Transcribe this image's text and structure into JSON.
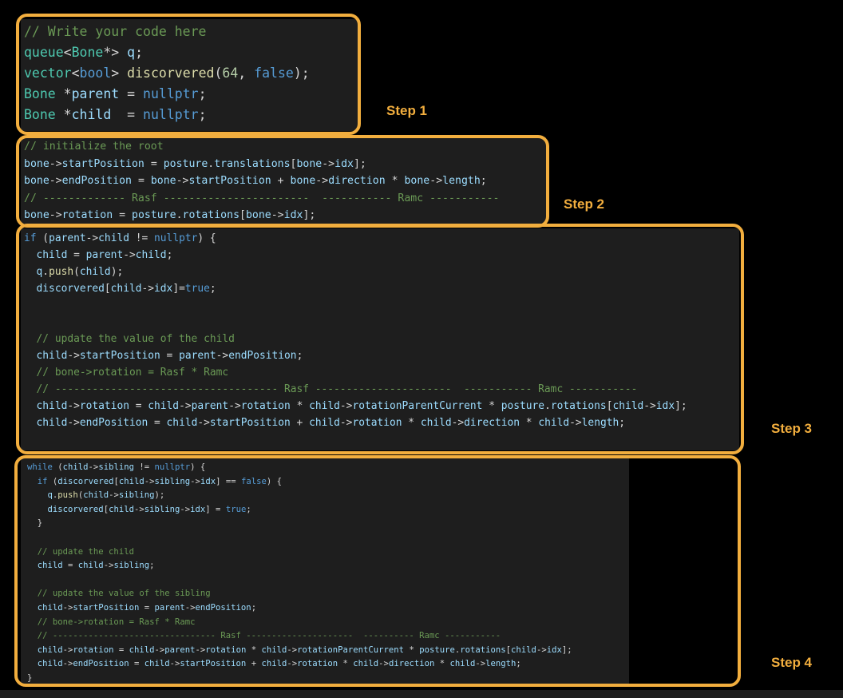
{
  "steps": [
    "Step 1",
    "Step 2",
    "Step 3",
    "Step 4"
  ],
  "code": {
    "step1": [
      [
        [
          "c",
          "// Write your code here"
        ]
      ],
      [
        [
          "t",
          "queue"
        ],
        [
          "p",
          "<"
        ],
        [
          "t",
          "Bone"
        ],
        [
          "p",
          "*> "
        ],
        [
          "v",
          "q"
        ],
        [
          "p",
          ";"
        ]
      ],
      [
        [
          "t",
          "vector"
        ],
        [
          "p",
          "<"
        ],
        [
          "k",
          "bool"
        ],
        [
          "p",
          "> "
        ],
        [
          "f",
          "discorvered"
        ],
        [
          "p",
          "("
        ],
        [
          "n",
          "64"
        ],
        [
          "p",
          ", "
        ],
        [
          "k",
          "false"
        ],
        [
          "p",
          ");"
        ]
      ],
      [
        [
          "t",
          "Bone"
        ],
        [
          "p",
          " *"
        ],
        [
          "v",
          "parent"
        ],
        [
          "p",
          " = "
        ],
        [
          "k",
          "nullptr"
        ],
        [
          "p",
          ";"
        ]
      ],
      [
        [
          "t",
          "Bone"
        ],
        [
          "p",
          " *"
        ],
        [
          "v",
          "child"
        ],
        [
          "p",
          "  = "
        ],
        [
          "k",
          "nullptr"
        ],
        [
          "p",
          ";"
        ]
      ]
    ],
    "step2": [
      [
        [
          "c",
          "// initialize the root"
        ]
      ],
      [
        [
          "v",
          "bone"
        ],
        [
          "p",
          "->"
        ],
        [
          "v",
          "startPosition"
        ],
        [
          "p",
          " = "
        ],
        [
          "v",
          "posture"
        ],
        [
          "p",
          "."
        ],
        [
          "v",
          "translations"
        ],
        [
          "p",
          "["
        ],
        [
          "v",
          "bone"
        ],
        [
          "p",
          "->"
        ],
        [
          "v",
          "idx"
        ],
        [
          "p",
          "];"
        ]
      ],
      [
        [
          "v",
          "bone"
        ],
        [
          "p",
          "->"
        ],
        [
          "v",
          "endPosition"
        ],
        [
          "p",
          " = "
        ],
        [
          "v",
          "bone"
        ],
        [
          "p",
          "->"
        ],
        [
          "v",
          "startPosition"
        ],
        [
          "p",
          " + "
        ],
        [
          "v",
          "bone"
        ],
        [
          "p",
          "->"
        ],
        [
          "v",
          "direction"
        ],
        [
          "p",
          " * "
        ],
        [
          "v",
          "bone"
        ],
        [
          "p",
          "->"
        ],
        [
          "v",
          "length"
        ],
        [
          "p",
          ";"
        ]
      ],
      [
        [
          "c",
          "// ------------- Rasf -----------------------  ----------- Ramc -----------"
        ]
      ],
      [
        [
          "v",
          "bone"
        ],
        [
          "p",
          "->"
        ],
        [
          "v",
          "rotation"
        ],
        [
          "p",
          " = "
        ],
        [
          "v",
          "posture"
        ],
        [
          "p",
          "."
        ],
        [
          "v",
          "rotations"
        ],
        [
          "p",
          "["
        ],
        [
          "v",
          "bone"
        ],
        [
          "p",
          "->"
        ],
        [
          "v",
          "idx"
        ],
        [
          "p",
          "];"
        ]
      ]
    ],
    "step3": [
      [
        [
          "k",
          "if"
        ],
        [
          "p",
          " ("
        ],
        [
          "v",
          "parent"
        ],
        [
          "p",
          "->"
        ],
        [
          "v",
          "child"
        ],
        [
          "p",
          " != "
        ],
        [
          "k",
          "nullptr"
        ],
        [
          "p",
          ") {"
        ]
      ],
      [
        [
          "p",
          "  "
        ],
        [
          "v",
          "child"
        ],
        [
          "p",
          " = "
        ],
        [
          "v",
          "parent"
        ],
        [
          "p",
          "->"
        ],
        [
          "v",
          "child"
        ],
        [
          "p",
          ";"
        ]
      ],
      [
        [
          "p",
          "  "
        ],
        [
          "v",
          "q"
        ],
        [
          "p",
          "."
        ],
        [
          "f",
          "push"
        ],
        [
          "p",
          "("
        ],
        [
          "v",
          "child"
        ],
        [
          "p",
          ");"
        ]
      ],
      [
        [
          "p",
          "  "
        ],
        [
          "v",
          "discorvered"
        ],
        [
          "p",
          "["
        ],
        [
          "v",
          "child"
        ],
        [
          "p",
          "->"
        ],
        [
          "v",
          "idx"
        ],
        [
          "p",
          "]="
        ],
        [
          "k",
          "true"
        ],
        [
          "p",
          ";"
        ]
      ],
      [
        [
          "p",
          ""
        ]
      ],
      [
        [
          "p",
          ""
        ]
      ],
      [
        [
          "p",
          "  "
        ],
        [
          "c",
          "// update the value of the child"
        ]
      ],
      [
        [
          "p",
          "  "
        ],
        [
          "v",
          "child"
        ],
        [
          "p",
          "->"
        ],
        [
          "v",
          "startPosition"
        ],
        [
          "p",
          " = "
        ],
        [
          "v",
          "parent"
        ],
        [
          "p",
          "->"
        ],
        [
          "v",
          "endPosition"
        ],
        [
          "p",
          ";"
        ]
      ],
      [
        [
          "p",
          "  "
        ],
        [
          "c",
          "// bone->rotation = Rasf * Ramc"
        ]
      ],
      [
        [
          "p",
          "  "
        ],
        [
          "c",
          "// ------------------------------------ Rasf ----------------------  ----------- Ramc -----------"
        ]
      ],
      [
        [
          "p",
          "  "
        ],
        [
          "v",
          "child"
        ],
        [
          "p",
          "->"
        ],
        [
          "v",
          "rotation"
        ],
        [
          "p",
          " = "
        ],
        [
          "v",
          "child"
        ],
        [
          "p",
          "->"
        ],
        [
          "v",
          "parent"
        ],
        [
          "p",
          "->"
        ],
        [
          "v",
          "rotation"
        ],
        [
          "p",
          " * "
        ],
        [
          "v",
          "child"
        ],
        [
          "p",
          "->"
        ],
        [
          "v",
          "rotationParentCurrent"
        ],
        [
          "p",
          " * "
        ],
        [
          "v",
          "posture"
        ],
        [
          "p",
          "."
        ],
        [
          "v",
          "rotations"
        ],
        [
          "p",
          "["
        ],
        [
          "v",
          "child"
        ],
        [
          "p",
          "->"
        ],
        [
          "v",
          "idx"
        ],
        [
          "p",
          "];"
        ]
      ],
      [
        [
          "p",
          "  "
        ],
        [
          "v",
          "child"
        ],
        [
          "p",
          "->"
        ],
        [
          "v",
          "endPosition"
        ],
        [
          "p",
          " = "
        ],
        [
          "v",
          "child"
        ],
        [
          "p",
          "->"
        ],
        [
          "v",
          "startPosition"
        ],
        [
          "p",
          " + "
        ],
        [
          "v",
          "child"
        ],
        [
          "p",
          "->"
        ],
        [
          "v",
          "rotation"
        ],
        [
          "p",
          " * "
        ],
        [
          "v",
          "child"
        ],
        [
          "p",
          "->"
        ],
        [
          "v",
          "direction"
        ],
        [
          "p",
          " * "
        ],
        [
          "v",
          "child"
        ],
        [
          "p",
          "->"
        ],
        [
          "v",
          "length"
        ],
        [
          "p",
          ";"
        ]
      ]
    ],
    "step4": [
      [
        [
          "k",
          "while"
        ],
        [
          "p",
          " ("
        ],
        [
          "v",
          "child"
        ],
        [
          "p",
          "->"
        ],
        [
          "v",
          "sibling"
        ],
        [
          "p",
          " != "
        ],
        [
          "k",
          "nullptr"
        ],
        [
          "p",
          ") {"
        ]
      ],
      [
        [
          "p",
          "  "
        ],
        [
          "k",
          "if"
        ],
        [
          "p",
          " ("
        ],
        [
          "v",
          "discorvered"
        ],
        [
          "p",
          "["
        ],
        [
          "v",
          "child"
        ],
        [
          "p",
          "->"
        ],
        [
          "v",
          "sibling"
        ],
        [
          "p",
          "->"
        ],
        [
          "v",
          "idx"
        ],
        [
          "p",
          "] == "
        ],
        [
          "k",
          "false"
        ],
        [
          "p",
          ") {"
        ]
      ],
      [
        [
          "p",
          "    "
        ],
        [
          "v",
          "q"
        ],
        [
          "p",
          "."
        ],
        [
          "f",
          "push"
        ],
        [
          "p",
          "("
        ],
        [
          "v",
          "child"
        ],
        [
          "p",
          "->"
        ],
        [
          "v",
          "sibling"
        ],
        [
          "p",
          ");"
        ]
      ],
      [
        [
          "p",
          "    "
        ],
        [
          "v",
          "discorvered"
        ],
        [
          "p",
          "["
        ],
        [
          "v",
          "child"
        ],
        [
          "p",
          "->"
        ],
        [
          "v",
          "sibling"
        ],
        [
          "p",
          "->"
        ],
        [
          "v",
          "idx"
        ],
        [
          "p",
          "] = "
        ],
        [
          "k",
          "true"
        ],
        [
          "p",
          ";"
        ]
      ],
      [
        [
          "p",
          "  }"
        ]
      ],
      [
        [
          "p",
          ""
        ]
      ],
      [
        [
          "p",
          "  "
        ],
        [
          "c",
          "// update the child"
        ]
      ],
      [
        [
          "p",
          "  "
        ],
        [
          "v",
          "child"
        ],
        [
          "p",
          " = "
        ],
        [
          "v",
          "child"
        ],
        [
          "p",
          "->"
        ],
        [
          "v",
          "sibling"
        ],
        [
          "p",
          ";"
        ]
      ],
      [
        [
          "p",
          ""
        ]
      ],
      [
        [
          "p",
          "  "
        ],
        [
          "c",
          "// update the value of the sibling"
        ]
      ],
      [
        [
          "p",
          "  "
        ],
        [
          "v",
          "child"
        ],
        [
          "p",
          "->"
        ],
        [
          "v",
          "startPosition"
        ],
        [
          "p",
          " = "
        ],
        [
          "v",
          "parent"
        ],
        [
          "p",
          "->"
        ],
        [
          "v",
          "endPosition"
        ],
        [
          "p",
          ";"
        ]
      ],
      [
        [
          "p",
          "  "
        ],
        [
          "c",
          "// bone->rotation = Rasf * Ramc"
        ]
      ],
      [
        [
          "p",
          "  "
        ],
        [
          "c",
          "// -------------------------------- Rasf ---------------------  ---------- Ramc -----------"
        ]
      ],
      [
        [
          "p",
          "  "
        ],
        [
          "v",
          "child"
        ],
        [
          "p",
          "->"
        ],
        [
          "v",
          "rotation"
        ],
        [
          "p",
          " = "
        ],
        [
          "v",
          "child"
        ],
        [
          "p",
          "->"
        ],
        [
          "v",
          "parent"
        ],
        [
          "p",
          "->"
        ],
        [
          "v",
          "rotation"
        ],
        [
          "p",
          " * "
        ],
        [
          "v",
          "child"
        ],
        [
          "p",
          "->"
        ],
        [
          "v",
          "rotationParentCurrent"
        ],
        [
          "p",
          " * "
        ],
        [
          "v",
          "posture"
        ],
        [
          "p",
          "."
        ],
        [
          "v",
          "rotations"
        ],
        [
          "p",
          "["
        ],
        [
          "v",
          "child"
        ],
        [
          "p",
          "->"
        ],
        [
          "v",
          "idx"
        ],
        [
          "p",
          "];"
        ]
      ],
      [
        [
          "p",
          "  "
        ],
        [
          "v",
          "child"
        ],
        [
          "p",
          "->"
        ],
        [
          "v",
          "endPosition"
        ],
        [
          "p",
          " = "
        ],
        [
          "v",
          "child"
        ],
        [
          "p",
          "->"
        ],
        [
          "v",
          "startPosition"
        ],
        [
          "p",
          " + "
        ],
        [
          "v",
          "child"
        ],
        [
          "p",
          "->"
        ],
        [
          "v",
          "rotation"
        ],
        [
          "p",
          " * "
        ],
        [
          "v",
          "child"
        ],
        [
          "p",
          "->"
        ],
        [
          "v",
          "direction"
        ],
        [
          "p",
          " * "
        ],
        [
          "v",
          "child"
        ],
        [
          "p",
          "->"
        ],
        [
          "v",
          "length"
        ],
        [
          "p",
          ";"
        ]
      ],
      [
        [
          "p",
          "}"
        ]
      ]
    ]
  },
  "colors": {
    "highlight": "#f2ae3e",
    "editor_bg": "#1e1e1e",
    "comment": "#6a9955",
    "keyword": "#569cd6",
    "type": "#4ec9b0",
    "variable": "#9cdcfe",
    "number": "#b5cea8",
    "function": "#dcdcaa",
    "punctuation": "#d4d4d4"
  }
}
